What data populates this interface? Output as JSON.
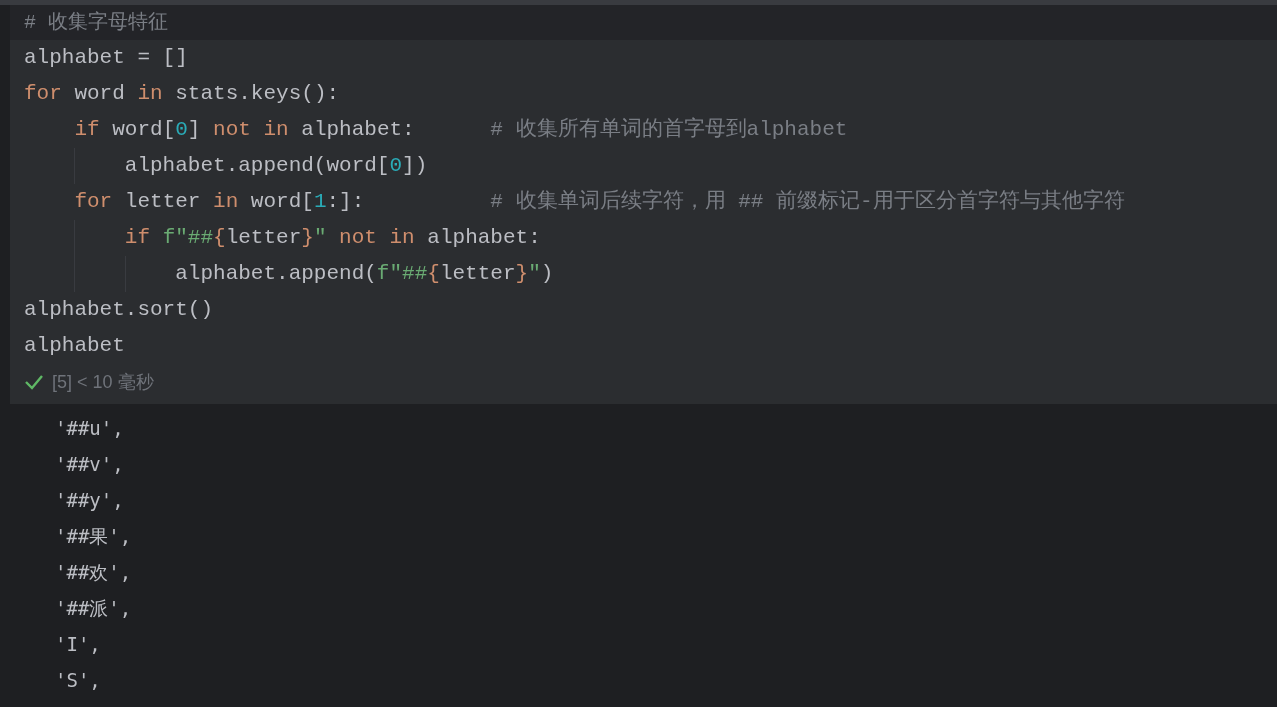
{
  "header_comment": "# 收集字母特征",
  "code_lines": [
    [
      {
        "text": "alphabet = []",
        "kind": "plain"
      }
    ],
    [
      {
        "text": "for",
        "kind": "keyword"
      },
      {
        "text": " word ",
        "kind": "plain"
      },
      {
        "text": "in",
        "kind": "keyword"
      },
      {
        "text": " stats.keys():",
        "kind": "plain"
      }
    ],
    [
      {
        "text": "    if",
        "kind": "keyword"
      },
      {
        "text": " word[",
        "kind": "plain"
      },
      {
        "text": "0",
        "kind": "number"
      },
      {
        "text": "] ",
        "kind": "plain"
      },
      {
        "text": "not in",
        "kind": "keyword"
      },
      {
        "text": " alphabet:      ",
        "kind": "plain"
      },
      {
        "text": "# 收集所有单词的首字母到alphabet",
        "kind": "comment"
      }
    ],
    [
      {
        "text": "        alphabet.append(word[",
        "kind": "plain"
      },
      {
        "text": "0",
        "kind": "number"
      },
      {
        "text": "])",
        "kind": "plain"
      }
    ],
    [
      {
        "text": "    for",
        "kind": "keyword"
      },
      {
        "text": " letter ",
        "kind": "plain"
      },
      {
        "text": "in",
        "kind": "keyword"
      },
      {
        "text": " word[",
        "kind": "plain"
      },
      {
        "text": "1",
        "kind": "number"
      },
      {
        "text": ":]:          ",
        "kind": "plain"
      },
      {
        "text": "# 收集单词后续字符，用 ## 前缀标记-用于区分首字符与其他字符",
        "kind": "comment"
      }
    ],
    [
      {
        "text": "        if ",
        "kind": "keyword"
      },
      {
        "text": "f\"##",
        "kind": "string"
      },
      {
        "text": "{",
        "kind": "keyword"
      },
      {
        "text": "letter",
        "kind": "plain"
      },
      {
        "text": "}",
        "kind": "keyword"
      },
      {
        "text": "\" ",
        "kind": "string"
      },
      {
        "text": "not in",
        "kind": "keyword"
      },
      {
        "text": " alphabet:",
        "kind": "plain"
      }
    ],
    [
      {
        "text": "            alphabet.append(",
        "kind": "plain"
      },
      {
        "text": "f\"##",
        "kind": "string"
      },
      {
        "text": "{",
        "kind": "keyword"
      },
      {
        "text": "letter",
        "kind": "plain"
      },
      {
        "text": "}",
        "kind": "keyword"
      },
      {
        "text": "\"",
        "kind": "string"
      },
      {
        "text": ")",
        "kind": "plain"
      }
    ],
    [
      {
        "text": "alphabet.sort()",
        "kind": "plain"
      }
    ],
    [
      {
        "text": "alphabet",
        "kind": "plain"
      }
    ]
  ],
  "run_status": {
    "succeeded": true,
    "text": "[5] < 10 毫秒"
  },
  "output_lines": [
    "'##u',",
    "'##v',",
    "'##y',",
    "'##果',",
    "'##欢',",
    "'##派',",
    "'I',",
    "'S',"
  ]
}
